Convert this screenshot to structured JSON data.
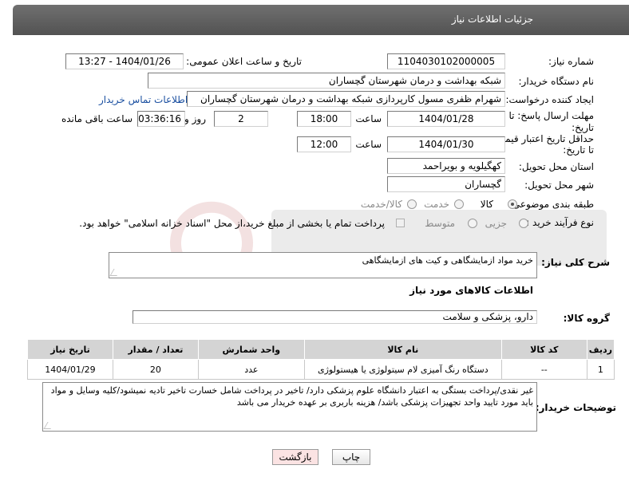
{
  "page": {
    "title": "جزئیات اطلاعات نیاز"
  },
  "fields": {
    "need_number_label": "شماره نیاز:",
    "need_number": "1104030102000005",
    "announce_label": "تاریخ و ساعت اعلان عمومی:",
    "announce_value": "1404/01/26 - 13:27",
    "buyer_label": "نام دستگاه خریدار:",
    "buyer_value": "شبکه بهداشت و درمان شهرستان گچساران",
    "creator_label": "ایجاد کننده درخواست:",
    "creator_value": "شهرام ظفری مسول کارپردازی  شبکه بهداشت و درمان شهرستان گچساران",
    "contact_link": "اطلاعات تماس خریدار",
    "deadline_label_1": "مهلت ارسال پاسخ: تا",
    "deadline_label_2": "تاریخ:",
    "deadline_date": "1404/01/28",
    "time_label": "ساعت",
    "deadline_time": "18:00",
    "days_value": "2",
    "days_label": "روز و",
    "remaining_value": "03:36:16",
    "remaining_label": "ساعت باقی مانده",
    "validity_label_1": "حداقل تاریخ اعتبار قیمت:",
    "validity_label_2": "تا تاریخ:",
    "validity_date": "1404/01/30",
    "validity_time_label": "ساعت",
    "validity_time": "12:00",
    "province_label": "استان محل تحویل:",
    "province_value": "کهگیلویه و بویراحمد",
    "city_label": "شهر محل تحویل:",
    "city_value": "گچساران",
    "category_label": "طبقه بندی موضوعی:",
    "category_options": [
      "کالا",
      "خدمت",
      "کالا/خدمت"
    ],
    "process_label": "نوع فرآیند خرید :",
    "process_options": [
      "جزیی",
      "متوسط"
    ],
    "payment_note": "پرداخت تمام یا بخشی از مبلغ خرید،از محل \"اسناد خزانه اسلامی\" خواهد بود."
  },
  "description": {
    "label": "شرح کلی نیاز:",
    "value": "خرید مواد ازمایشگاهی و کیت های ازمایشگاهی"
  },
  "goods": {
    "section_title": "اطلاعات کالاهای مورد نیاز",
    "group_label": "گروه کالا:",
    "group_value": "دارو، پزشکی و سلامت",
    "columns": [
      "ردیف",
      "کد کالا",
      "نام کالا",
      "واحد شمارش",
      "تعداد / مقدار",
      "تاریخ نیاز"
    ],
    "rows": [
      [
        "1",
        "--",
        "دستگاه رنگ آمیزی لام سیتولوژی یا هیستولوژی",
        "عدد",
        "20",
        "1404/01/29"
      ]
    ]
  },
  "buyer_notes": {
    "label": "توضیحات خریدار:",
    "value": "غیر نقدی/پرداخت بستگی به اعتبار دانشگاه علوم پزشکی دارد/ تاخیر در پرداخت شامل خسارت تاخیر تادیه نمیشود/کلیه وسایل و مواد باید مورد تایید واحد تجهیزات پزشکی باشد/ هزینه باربری بر عهده خریدار می باشد"
  },
  "buttons": {
    "print": "چاپ",
    "back": "بازگشت"
  },
  "colors": {
    "header": "#5a5a5a",
    "link": "#1a4fa0",
    "back_button_bg": "#fbe3e3"
  }
}
